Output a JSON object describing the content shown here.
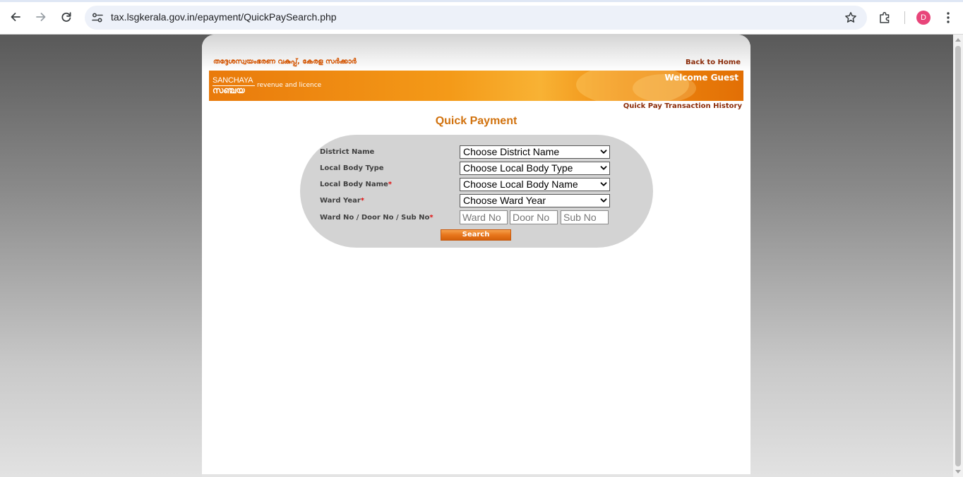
{
  "browser": {
    "url": "tax.lsgkerala.gov.in/epayment/QuickPaySearch.php",
    "profile_initial": "D",
    "icons": {
      "back": "arrow-left-icon",
      "forward": "arrow-right-icon",
      "reload": "reload-icon",
      "site_info": "tune-icon",
      "bookmark": "star-icon",
      "extensions": "puzzle-icon",
      "menu": "kebab-menu-icon"
    },
    "profile_color": "#e8457a"
  },
  "header": {
    "department": "തദ്ദേശസ്വയംഭരണ വകുപ്പ്, കേരള സർക്കാർ",
    "back_to_home": "Back to Home",
    "logo_en": "SANCHAYA",
    "logo_ml": "സഞ്ചയ",
    "tagline": "revenue and licence",
    "welcome": "Welcome Guest",
    "history_link": "Quick Pay Transaction History",
    "accent_color": "#f49a18"
  },
  "main": {
    "title": "Quick Payment",
    "form": {
      "district_label": "District Name",
      "district_value": "Choose District Name",
      "lb_type_label": "Local Body Type",
      "lb_type_value": "Choose Local Body Type",
      "lb_name_label": "Local Body Name",
      "lb_name_value": "Choose Local Body Name",
      "ward_year_label": "Ward Year",
      "ward_year_value": "Choose Ward Year",
      "ward_door_label": "Ward No / Door No / Sub No",
      "ward_no_placeholder": "Ward No",
      "door_no_placeholder": "Door No",
      "sub_no_placeholder": "Sub No",
      "required_mark": "*",
      "search_label": "Search"
    }
  }
}
